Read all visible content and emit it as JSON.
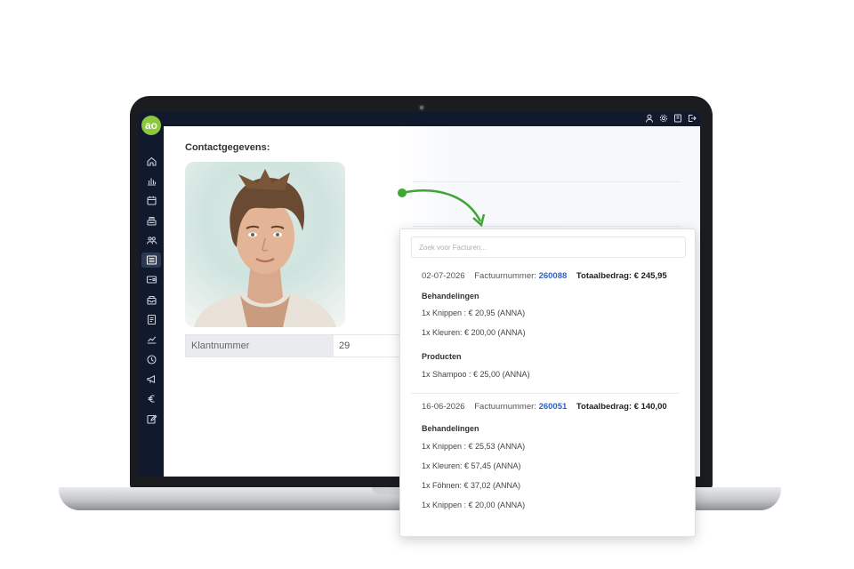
{
  "app": {
    "logo_text": "ao",
    "brand_color": "#8dc63f",
    "sidebar_color": "#111a2c",
    "accent_link_color": "#2f63c7"
  },
  "topbar": {
    "icons": [
      "user-icon",
      "settings-icon",
      "book-icon",
      "logout-icon"
    ]
  },
  "sidebar": {
    "items": [
      {
        "icon": "home-icon"
      },
      {
        "icon": "bar-chart-icon"
      },
      {
        "icon": "calendar-icon"
      },
      {
        "icon": "register-icon"
      },
      {
        "icon": "customers-icon"
      },
      {
        "icon": "list-icon",
        "active": true
      },
      {
        "icon": "card-icon"
      },
      {
        "icon": "inbox-icon"
      },
      {
        "icon": "document-icon"
      },
      {
        "icon": "trend-icon"
      },
      {
        "icon": "clock-icon"
      },
      {
        "icon": "megaphone-icon"
      },
      {
        "icon": "euro-icon"
      },
      {
        "icon": "edit-icon"
      }
    ]
  },
  "contact": {
    "title": "Contactgegevens:",
    "fields": [
      {
        "label": "Klantnummer",
        "value": "29"
      }
    ]
  },
  "popup": {
    "search_placeholder": "Zoek voor Facturen...",
    "invoices": [
      {
        "date": "02-07-2026",
        "number_label": "Factuurnummer:",
        "number": "260088",
        "total_label": "Totaalbedrag:",
        "total": "€ 245,95",
        "groups": [
          {
            "title": "Behandelingen",
            "items": [
              "1x Knippen : € 20,95 (ANNA)",
              "1x Kleuren: € 200,00 (ANNA)"
            ]
          },
          {
            "title": "Producten",
            "items": [
              "1x Shampoo : € 25,00 (ANNA)"
            ]
          }
        ]
      },
      {
        "date": "16-06-2026",
        "number_label": "Factuurnummer:",
        "number": "260051",
        "total_label": "Totaalbedrag:",
        "total": "€ 140,00",
        "groups": [
          {
            "title": "Behandelingen",
            "items": [
              "1x Knippen : € 25,53 (ANNA)",
              "1x Kleuren: € 57,45 (ANNA)",
              "1x Föhnen: € 37,02 (ANNA)",
              "1x Knippen : € 20,00 (ANNA)"
            ]
          }
        ]
      }
    ]
  }
}
